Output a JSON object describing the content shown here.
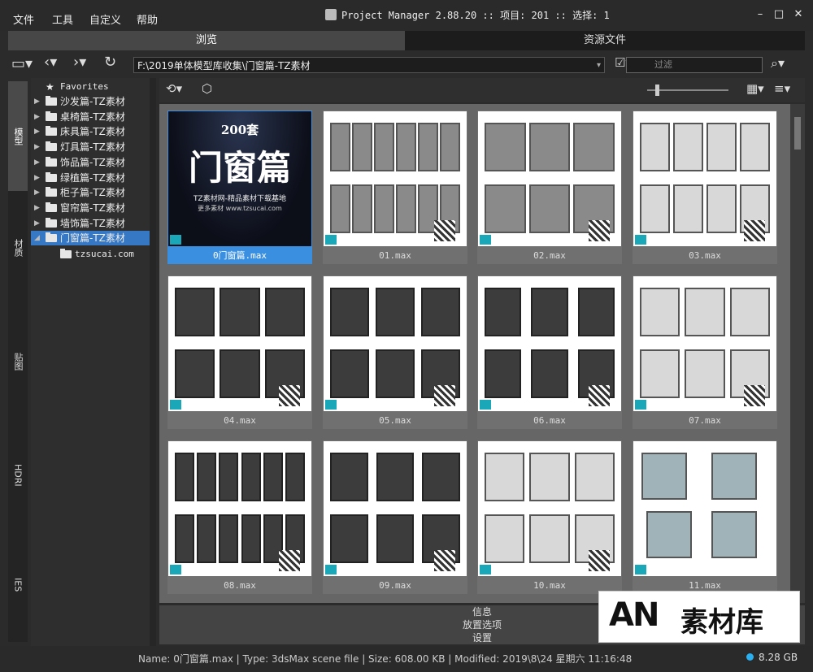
{
  "menu": [
    "文件",
    "工具",
    "自定义",
    "帮助"
  ],
  "title": "Project Manager 2.88.20  :: 项目: 201  :: 选择: 1",
  "window_controls": {
    "minimize": "–",
    "maximize": "□",
    "close": "✕"
  },
  "tabs": {
    "browse": "浏览",
    "assets": "资源文件"
  },
  "path": "F:\\2019单体模型库收集\\门窗篇-TZ素材",
  "filter_placeholder": "过滤",
  "vertical_tabs": [
    "模型",
    "材质",
    "贴图",
    "HDRI",
    "IES"
  ],
  "tree": {
    "favorites": "Favorites",
    "folders": [
      "沙发篇-TZ素材",
      "桌椅篇-TZ素材",
      "床具篇-TZ素材",
      "灯具篇-TZ素材",
      "饰品篇-TZ素材",
      "绿植篇-TZ素材",
      "柜子篇-TZ素材",
      "窗帘篇-TZ素材",
      "墙饰篇-TZ素材",
      "门窗篇-TZ素材"
    ],
    "selected_index": 9,
    "subfolder": "tzsucai.com"
  },
  "thumbnails": [
    "0门窗篇.max",
    "01.max",
    "02.max",
    "03.max",
    "04.max",
    "05.max",
    "06.max",
    "07.max",
    "08.max",
    "09.max",
    "10.max",
    "11.max"
  ],
  "cover": {
    "count": "200套",
    "title": "门窗篇",
    "line1": "TZ素材网-精品素材下载基地",
    "line2": "更多素材 www.tzsucai.com"
  },
  "panels": [
    "信息",
    "放置选项",
    "设置"
  ],
  "status": "Name: 0门窗篇.max | Type: 3dsMax scene file | Size: 608.00 KB | Modified: 2019\\8\\24 星期六 11:16:48",
  "disk": "8.28 GB",
  "watermark": {
    "logo": "AN",
    "text": "素材库"
  },
  "colors": {
    "selection": "#3778c4",
    "tile_selected": "#3a8fe0",
    "disk_indicator": "#2ab0f0"
  }
}
